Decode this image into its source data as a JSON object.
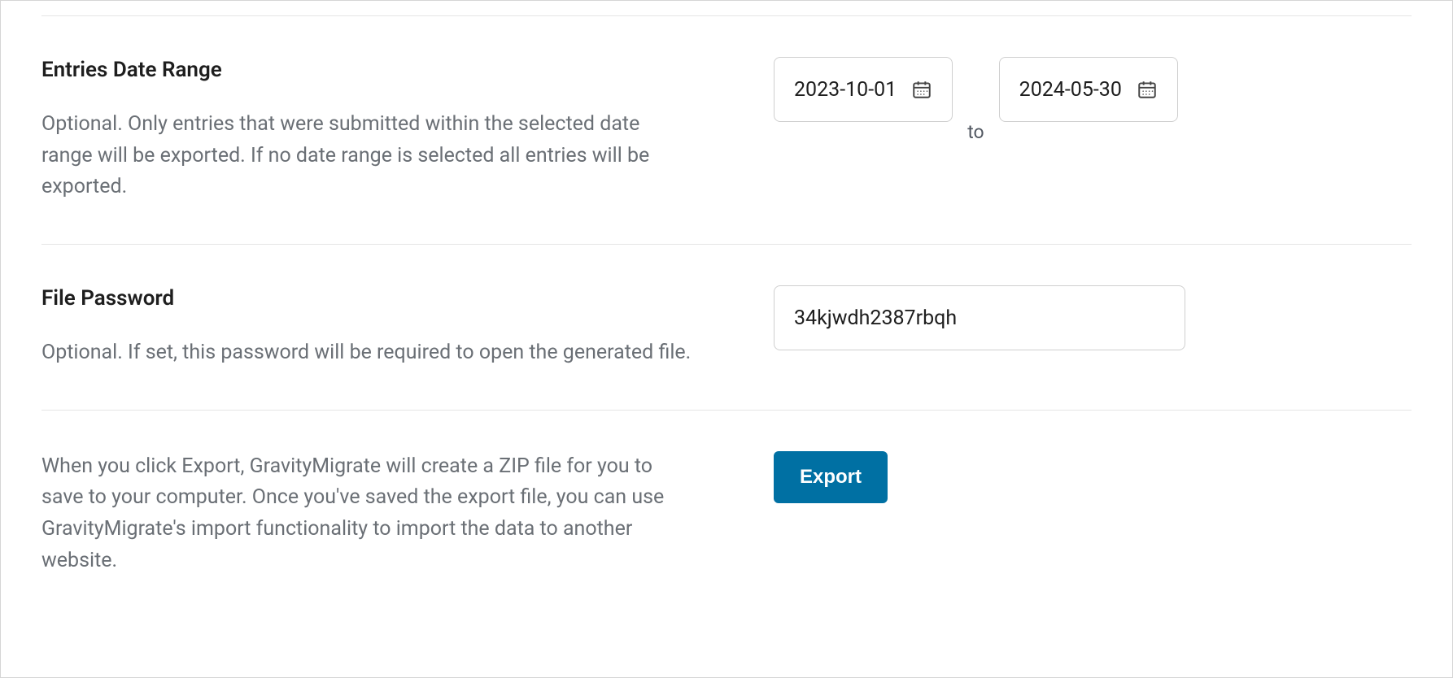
{
  "dateRange": {
    "title": "Entries Date Range",
    "description": "Optional. Only entries that were submitted within the selected date range will be exported. If no date range is selected all entries will be exported.",
    "start": "2023-10-01",
    "end": "2024-05-30",
    "separator": "to"
  },
  "filePassword": {
    "title": "File Password",
    "description": "Optional. If set, this password will be required to open the generated file.",
    "value": "34kjwdh2387rbqh"
  },
  "export": {
    "description": "When you click Export, GravityMigrate will create a ZIP file for you to save to your computer. Once you've saved the export file, you can use GravityMigrate's import functionality to import the data to another website.",
    "buttonLabel": "Export"
  }
}
